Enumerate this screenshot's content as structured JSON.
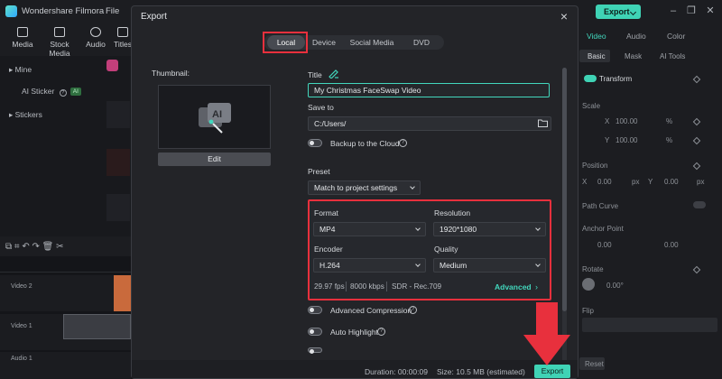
{
  "app": {
    "title": "Wondershare Filmora",
    "menu_file": "File",
    "export_label": "Export",
    "toolbar": [
      "Media",
      "Stock Media",
      "Audio",
      "Titles"
    ]
  },
  "left_panel": {
    "items": [
      {
        "label": "Mine"
      },
      {
        "label": "AI Sticker",
        "badge": "AI"
      },
      {
        "label": "Stickers"
      }
    ]
  },
  "timeline": {
    "tracks": [
      "Video 2",
      "Video 1",
      "Audio 1"
    ]
  },
  "right_panel": {
    "tabs": [
      "Video",
      "Audio",
      "Color"
    ],
    "subtabs": [
      "Basic",
      "Mask",
      "AI Tools"
    ],
    "transform_label": "Transform",
    "scale_label": "Scale",
    "scale_x_axis": "X",
    "scale_x": "100.00",
    "scale_y_axis": "Y",
    "scale_y": "100.00",
    "percent": "%",
    "position_label": "Position",
    "pos_x_axis": "X",
    "pos_x": "0.00",
    "pos_y_axis": "Y",
    "pos_y": "0.00",
    "unit_px": "px",
    "path_curve_label": "Path Curve",
    "anchor_point_label": "Anchor Point",
    "anchor_x": "0.00",
    "anchor_y": "0.00",
    "rotate_label": "Rotate",
    "rotate_val": "0.00°",
    "flip_label": "Flip",
    "reset_label": "Reset"
  },
  "dialog": {
    "title": "Export",
    "tabs": [
      {
        "label": "Local",
        "active": true
      },
      {
        "label": "Device",
        "active": false
      },
      {
        "label": "Social Media",
        "active": false
      },
      {
        "label": "DVD",
        "active": false
      }
    ],
    "thumbnail_label": "Thumbnail:",
    "edit_label": "Edit",
    "title_label": "Title",
    "title_value": "My Christmas FaceSwap Video",
    "save_to_label": "Save to",
    "save_to_value": "C:/Users/",
    "backup_label": "Backup to the Cloud",
    "preset_label": "Preset",
    "preset_value": "Match to project settings",
    "format_label": "Format",
    "format_value": "MP4",
    "resolution_label": "Resolution",
    "resolution_value": "1920*1080",
    "encoder_label": "Encoder",
    "encoder_value": "H.264",
    "quality_label": "Quality",
    "quality_value": "Medium",
    "fps": "29.97 fps",
    "bitrate": "8000 kbps",
    "color_space": "SDR - Rec.709",
    "advanced_label": "Advanced",
    "adv_compression_label": "Advanced Compression",
    "auto_highlight_label": "Auto Highlight",
    "duration_text": "Duration: 00:00:09",
    "size_text": "Size:  10.5 MB (estimated)",
    "export_label": "Export"
  },
  "colors": {
    "accent": "#3fd3b5",
    "highlight_red": "#e8303d",
    "dialog_bg": "#232428"
  },
  "icons": [
    "close-icon",
    "pencil-icon",
    "folder-icon",
    "help-icon",
    "chevron-down-icon",
    "chevron-right-icon",
    "arrow-down-icon",
    "ai-image-icon"
  ]
}
